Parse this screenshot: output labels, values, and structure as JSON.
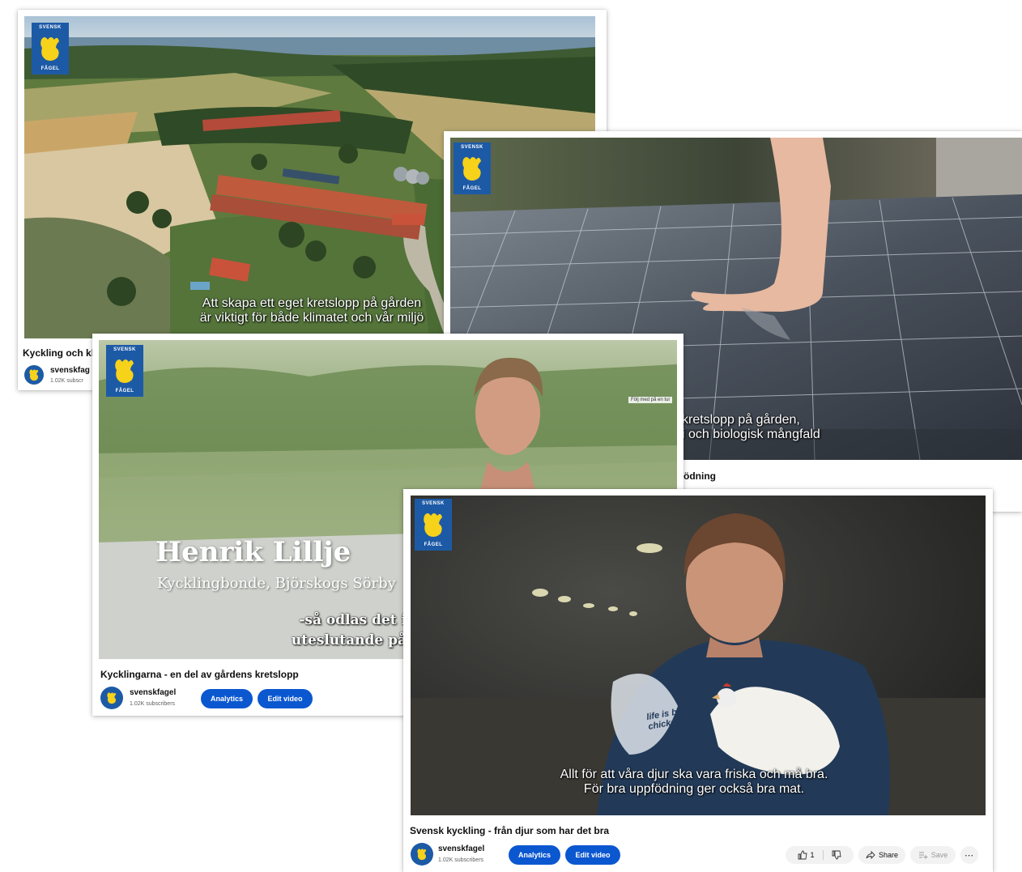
{
  "logo": {
    "top": "SVENSK",
    "bottom": "FÅGEL"
  },
  "channel": {
    "name": "svenskfagel",
    "subscribers": "1.02K subscribers"
  },
  "buttons": {
    "analytics": "Analytics",
    "edit": "Edit video"
  },
  "cards": [
    {
      "subtitle_line1": "Att skapa ett eget kretslopp på gården",
      "subtitle_line2": "är viktigt för både klimatet och vår miljö",
      "title": "Kyckling och kl",
      "channel": "svenskfag",
      "subscribers": "1.02K subscr"
    },
    {
      "subtitle_line1": "kretslopp på gården,",
      "subtitle_line2": "i och biologisk mångfald",
      "title": "födning"
    },
    {
      "name_overlay": "Henrik Lillje",
      "role_overlay": "Kycklingbonde, Björskogs Sörby",
      "subtitle_line1": "-så odlas det i",
      "subtitle_line2": "uteslutande på",
      "badge": "Följ med på en tur",
      "title": "Kycklingarna - en del av gårdens kretslopp"
    },
    {
      "subtitle_line1": "Allt för att våra djur ska vara friska och må bra.",
      "subtitle_line2": "För bra uppfödning ger också bra mat.",
      "shirt_text": "life is better chicken",
      "title": "Svensk kyckling - från djur som har det bra",
      "like_count": "1",
      "share": "Share",
      "save": "Save"
    }
  ]
}
